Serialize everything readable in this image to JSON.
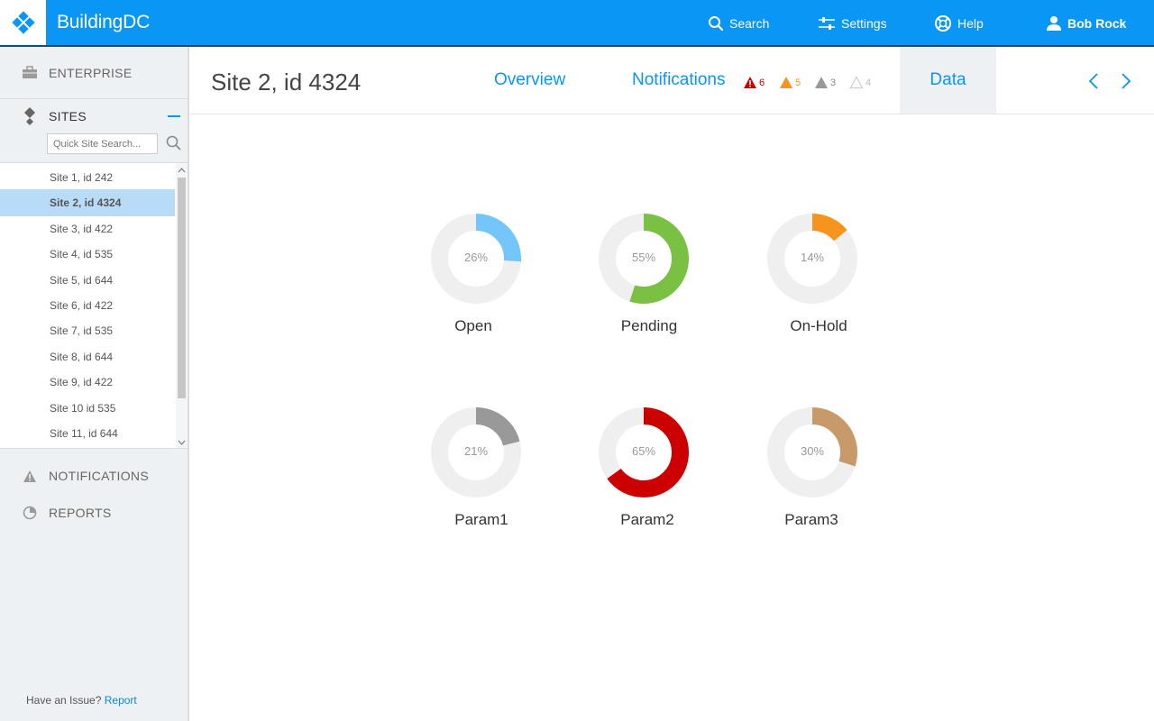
{
  "app": {
    "brand": "BuildingDC"
  },
  "topnav": {
    "search": "Search",
    "settings": "Settings",
    "help": "Help",
    "user": "Bob Rock"
  },
  "sidebar": {
    "enterprise": "ENTERPRISE",
    "sites": "SITES",
    "quick_search_placeholder": "Quick Site Search...",
    "site_items": [
      {
        "label": "Site 1, id 242",
        "active": false
      },
      {
        "label": "Site 2, id 4324",
        "active": true
      },
      {
        "label": "Site 3, id 422",
        "active": false
      },
      {
        "label": "Site 4, id 535",
        "active": false
      },
      {
        "label": "Site 5, id 644",
        "active": false
      },
      {
        "label": "Site 6, id 422",
        "active": false
      },
      {
        "label": "Site 7, id 535",
        "active": false
      },
      {
        "label": "Site 8, id 644",
        "active": false
      },
      {
        "label": "Site 9, id 422",
        "active": false
      },
      {
        "label": "Site 10 id 535",
        "active": false
      },
      {
        "label": "Site 11, id 644",
        "active": false
      }
    ],
    "notifications": "NOTIFICATIONS",
    "reports": "REPORTS",
    "issue_text": "Have an Issue?",
    "issue_link": "Report"
  },
  "header": {
    "title": "Site 2, id 4324",
    "tabs": {
      "overview": "Overview",
      "notifications": "Notifications",
      "data": "Data"
    },
    "badges": [
      {
        "count": "6",
        "color": "#cc0000",
        "style": "filled"
      },
      {
        "count": "5",
        "color": "#f7941d",
        "style": "filled"
      },
      {
        "count": "3",
        "color": "#999999",
        "style": "filled"
      },
      {
        "count": "4",
        "color": "#cccccc",
        "style": "outline"
      }
    ]
  },
  "chart_data": [
    {
      "type": "pie",
      "label": "Open",
      "value": 26,
      "value_text": "26%",
      "color": "#73c6f7"
    },
    {
      "type": "pie",
      "label": "Pending",
      "value": 55,
      "value_text": "55%",
      "color": "#7ac143"
    },
    {
      "type": "pie",
      "label": "On-Hold",
      "value": 14,
      "value_text": "14%",
      "color": "#f7941d"
    },
    {
      "type": "pie",
      "label": "Param1",
      "value": 21,
      "value_text": "21%",
      "color": "#999999"
    },
    {
      "type": "pie",
      "label": "Param2",
      "value": 65,
      "value_text": "65%",
      "color": "#cc0000"
    },
    {
      "type": "pie",
      "label": "Param3",
      "value": 30,
      "value_text": "30%",
      "color": "#c89a6a"
    }
  ],
  "colors": {
    "accent": "#0a96f5",
    "track": "#efefef"
  }
}
